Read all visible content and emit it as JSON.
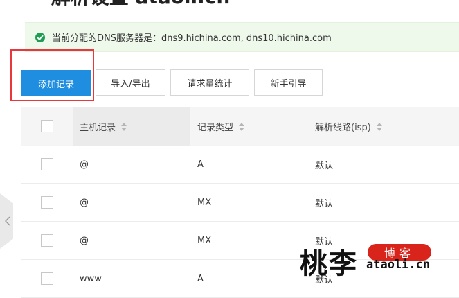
{
  "header": {
    "back_glyph": "←",
    "title": "解析设置 ataoli.cn"
  },
  "notice": {
    "icon": "check-circle-icon",
    "text": "当前分配的DNS服务器是：dns9.hichina.com, dns10.hichina.com"
  },
  "toolbar": {
    "add_record": "添加记录",
    "import_export": "导入/导出",
    "request_stats": "请求量统计",
    "beginner_guide": "新手引导"
  },
  "table": {
    "columns": [
      "主机记录",
      "记录类型",
      "解析线路(isp)"
    ],
    "rows": [
      {
        "host": "@",
        "type": "A",
        "line": "默认"
      },
      {
        "host": "@",
        "type": "MX",
        "line": "默认"
      },
      {
        "host": "@",
        "type": "MX",
        "line": "默认"
      },
      {
        "host": "www",
        "type": "A",
        "line": "默认"
      }
    ]
  },
  "watermark": {
    "name": "桃李",
    "tag": "博客",
    "domain": "ataoli.cn"
  },
  "colors": {
    "primary": "#1f8ee0",
    "success": "#1f9d55",
    "notice_bg": "#eef9ec",
    "highlight": "#e8383d",
    "watermark_red": "#d9241c"
  }
}
